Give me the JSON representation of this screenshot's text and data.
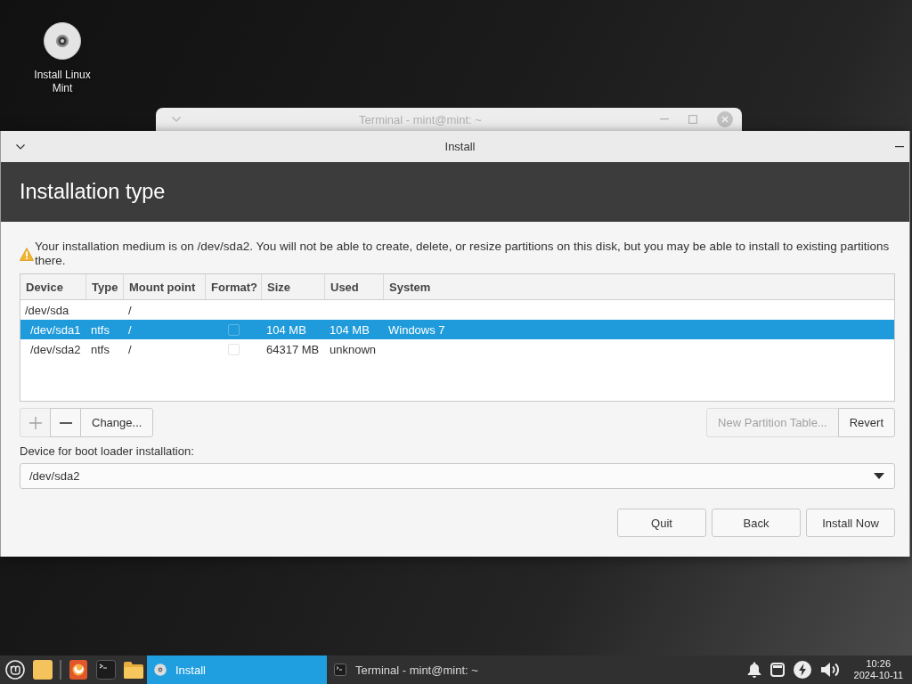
{
  "desktop": {
    "icons": [
      {
        "label": "Install Linux Mint"
      }
    ]
  },
  "background_window": {
    "title": "Terminal - mint@mint: ~",
    "active": false
  },
  "install_window": {
    "title": "Install",
    "active": true,
    "heading": "Installation type",
    "warning": "Your installation medium is on /dev/sda2. You will not be able to create, delete, or resize partitions on this disk, but you may be able to install to existing partitions there.",
    "table": {
      "columns": [
        "Device",
        "Type",
        "Mount point",
        "Format?",
        "Size",
        "Used",
        "System"
      ],
      "rows": [
        {
          "device": "/dev/sda",
          "mount_point": "/",
          "selected": false,
          "children": [
            {
              "device": "/dev/sda1",
              "type": "ntfs",
              "mount_point": "/",
              "format": false,
              "size": "104 MB",
              "used": "104 MB",
              "system": "Windows 7",
              "selected": true
            },
            {
              "device": "/dev/sda2",
              "type": "ntfs",
              "mount_point": "/",
              "format": false,
              "size": "64317 MB",
              "used": "unknown",
              "selected": false
            }
          ]
        }
      ]
    },
    "partition_buttons": [
      {
        "kind": "add",
        "disabled": true
      },
      {
        "kind": "remove",
        "disabled": false
      },
      {
        "kind": "text",
        "label": "Change...",
        "disabled": false
      }
    ],
    "table_buttons": [
      {
        "label": "New Partition Table...",
        "disabled": true
      },
      {
        "label": "Revert",
        "disabled": false
      }
    ],
    "bootloader": {
      "label": "Device for boot loader installation:",
      "value": "/dev/sda2"
    },
    "actions": [
      {
        "label": "Quit"
      },
      {
        "label": "Back"
      },
      {
        "label": "Install Now"
      }
    ]
  },
  "taskbar": {
    "launchers": [
      {
        "kind": "menu"
      },
      {
        "kind": "tile"
      },
      {
        "kind": "separator"
      },
      {
        "kind": "browser"
      },
      {
        "kind": "terminal"
      },
      {
        "kind": "folder"
      }
    ],
    "tasks": [
      {
        "kind": "installer",
        "title": "Install",
        "selected": true
      },
      {
        "kind": "terminal",
        "title": "Terminal - mint@mint: ~",
        "selected": false
      }
    ],
    "tray": [
      {
        "kind": "bell"
      },
      {
        "kind": "window"
      },
      {
        "kind": "lightning"
      },
      {
        "kind": "volume"
      }
    ],
    "clock": {
      "time": "10:26",
      "date": "2024-10-11"
    }
  }
}
